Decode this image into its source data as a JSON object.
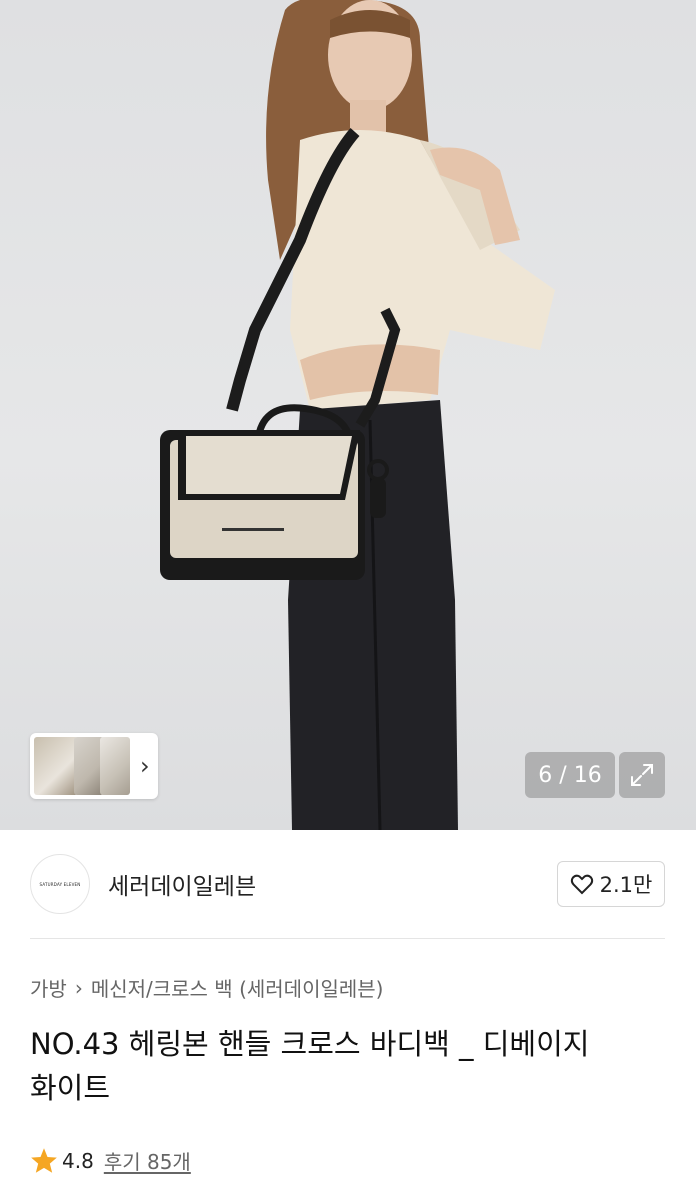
{
  "gallery": {
    "counter": "6 / 16",
    "icons": {
      "next": "chevron-right-icon",
      "expand": "expand-icon"
    }
  },
  "seller": {
    "logo_text": "SATURDAY ELEVEN",
    "name": "세러데이일레븐",
    "like_count": "2.1만"
  },
  "breadcrumb": {
    "items": [
      "가방",
      "메신저/크로스 백 (세러데이일레븐)"
    ]
  },
  "product": {
    "title_line1": "NO.43 헤링본 핸들 크로스 바디백 _ 디베이지",
    "title_line2": "화이트",
    "rating": "4.8",
    "reviews": "후기 85개",
    "star_color": "#f5a623"
  }
}
